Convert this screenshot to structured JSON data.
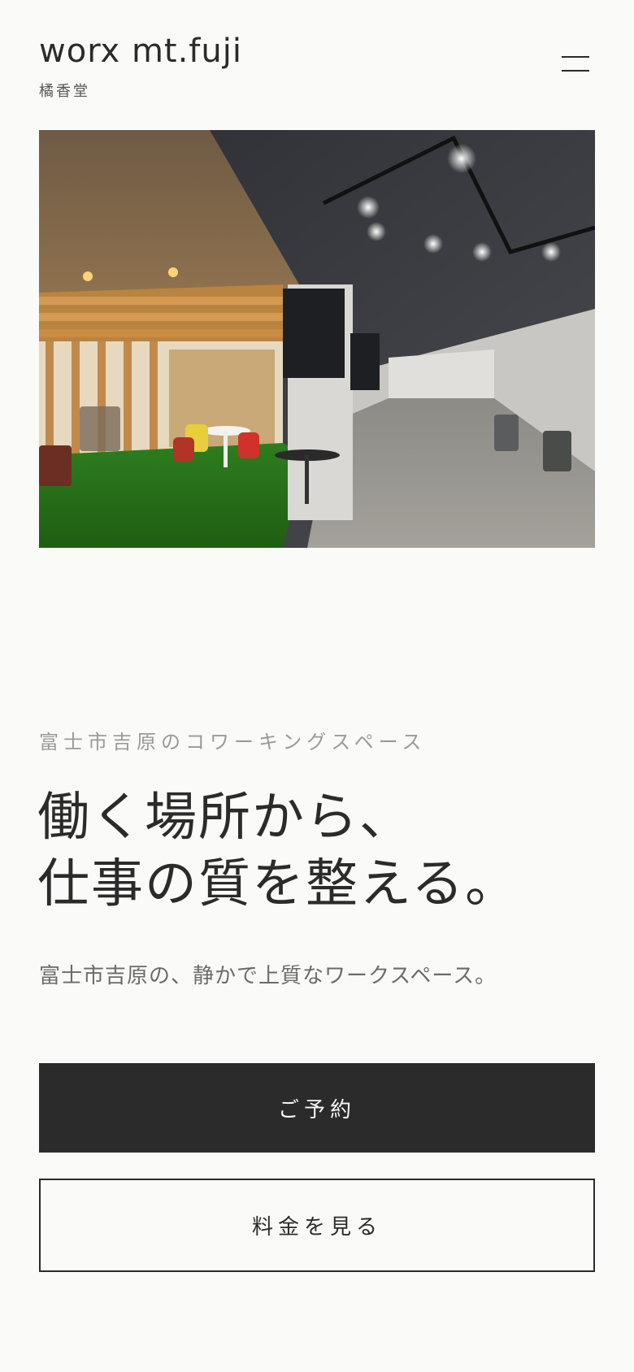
{
  "header": {
    "brand_name": "worx mt.fuji",
    "brand_sub": "橘香堂",
    "menu_icon": "hamburger-menu-icon"
  },
  "hero": {
    "image_alt": "Coworking space interior"
  },
  "intro": {
    "eyebrow": "富士市吉原のコワーキングスペース",
    "headline_line1": "働く場所から、",
    "headline_line2": "仕事の質を整える。",
    "subcopy": "富士市吉原の、静かで上質なワークスペース。"
  },
  "cta": {
    "reserve_label": "ご予約",
    "pricing_label": "料金を見る"
  }
}
